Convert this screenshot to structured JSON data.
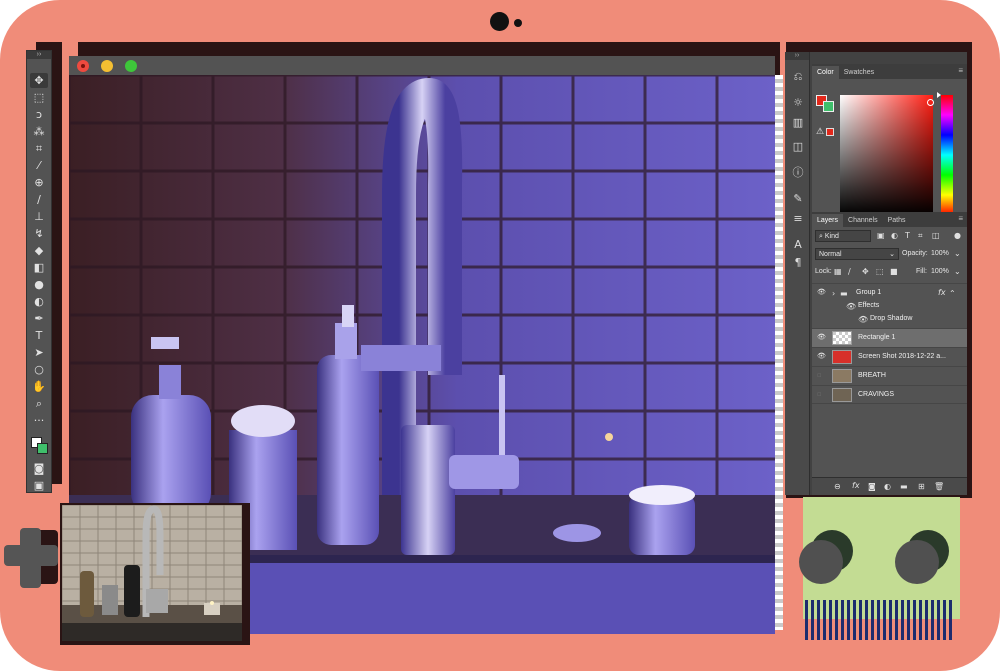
{
  "window": {
    "controls": [
      "close",
      "minimize",
      "zoom"
    ]
  },
  "toolbar": {
    "tools": [
      "move-icon",
      "marquee-icon",
      "lasso-icon",
      "magic-wand-icon",
      "crop-icon",
      "eyedropper-icon",
      "healing-icon",
      "brush-icon",
      "stamp-icon",
      "history-brush-icon",
      "eraser-icon",
      "gradient-icon",
      "blur-icon",
      "dodge-icon",
      "pen-icon",
      "type-icon",
      "path-select-icon",
      "shape-icon",
      "hand-icon",
      "zoom-icon",
      "more-icon"
    ],
    "type_tool_label": "T"
  },
  "color_panel": {
    "tabs": [
      "Color",
      "Swatches"
    ],
    "foreground": "#e2281b",
    "background": "#3fbf6b"
  },
  "layers_panel": {
    "tabs": [
      "Layers",
      "Channels",
      "Paths"
    ],
    "filter": "Kind",
    "blend_mode": "Normal",
    "opacity_label": "Opacity:",
    "opacity_value": "100%",
    "lock_label": "Lock:",
    "fill_label": "Fill:",
    "fill_value": "100%",
    "layers": [
      {
        "name": "Group 1",
        "visible": true,
        "kind": "group",
        "fx": "fx"
      },
      {
        "name": "Effects",
        "visible": true,
        "kind": "effects"
      },
      {
        "name": "Drop Shadow",
        "visible": true,
        "kind": "effect"
      },
      {
        "name": "Rectangle 1",
        "visible": true,
        "kind": "shape",
        "selected": true
      },
      {
        "name": "Screen Shot 2018-12-22 a...",
        "visible": true,
        "kind": "image"
      },
      {
        "name": "BREATH",
        "visible": false,
        "kind": "image"
      },
      {
        "name": "CRAVINGS",
        "visible": false,
        "kind": "image"
      }
    ]
  },
  "colors": {
    "device": "#f08c79",
    "canvas_tint": "#5b4fbd",
    "pad": "#c3dc93"
  }
}
